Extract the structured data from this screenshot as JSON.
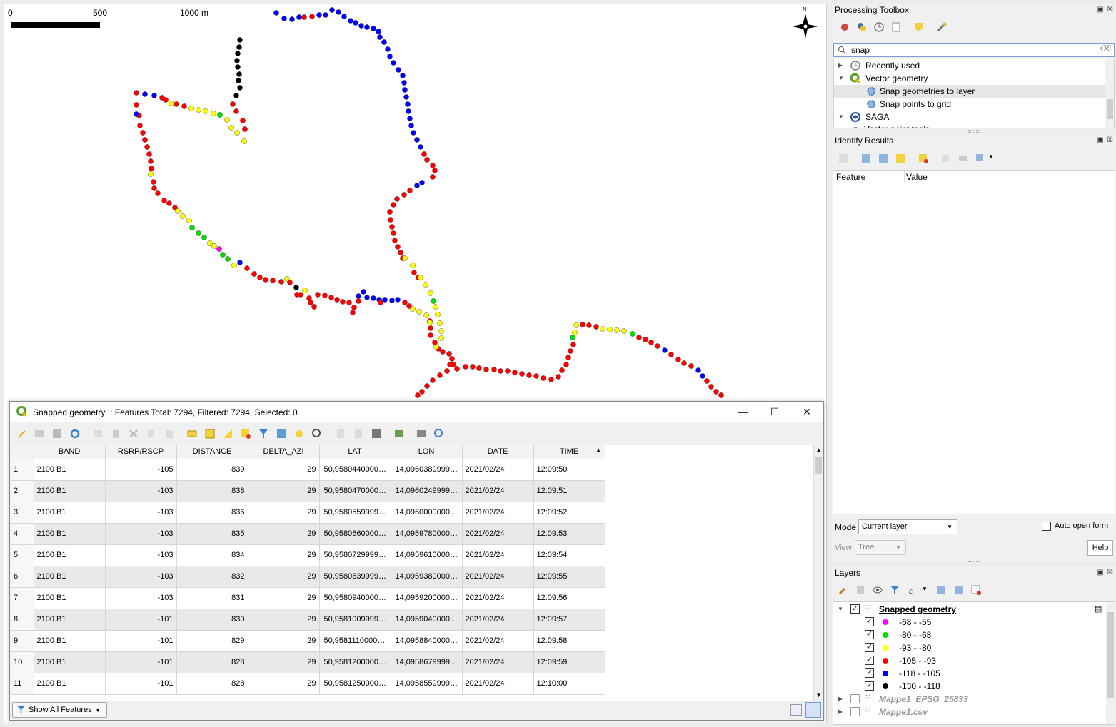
{
  "map": {
    "scale_labels": [
      "0",
      "500",
      "1000 m"
    ],
    "north_label": "N",
    "colors": {
      "magenta": "#ff00ff",
      "green": "#00dd00",
      "yellow": "#ffff00",
      "red": "#ff0000",
      "blue": "#0000ff",
      "black": "#000000"
    }
  },
  "attribute_table": {
    "title": "Snapped geometry :: Features Total: 7294, Filtered: 7294, Selected: 0",
    "columns": [
      "BAND",
      "RSRP/RSCP",
      "DISTANCE",
      "DELTA_AZI",
      "LAT",
      "LON",
      "DATE",
      "TIME"
    ],
    "rows": [
      {
        "n": "1",
        "band": "2100 B1",
        "rsrp": "-105",
        "distance": "839",
        "delta_azi": "29",
        "lat": "50,95804400000...",
        "lon": "14,09603899999...",
        "date": "2021/02/24",
        "time": "12:09:50"
      },
      {
        "n": "2",
        "band": "2100 B1",
        "rsrp": "-103",
        "distance": "838",
        "delta_azi": "29",
        "lat": "50,95804700000...",
        "lon": "14,09602499999...",
        "date": "2021/02/24",
        "time": "12:09:51"
      },
      {
        "n": "3",
        "band": "2100 B1",
        "rsrp": "-103",
        "distance": "836",
        "delta_azi": "29",
        "lat": "50,95805599999...",
        "lon": "14,09600000000...",
        "date": "2021/02/24",
        "time": "12:09:52"
      },
      {
        "n": "4",
        "band": "2100 B1",
        "rsrp": "-103",
        "distance": "835",
        "delta_azi": "29",
        "lat": "50,95806600000...",
        "lon": "14,09597800000...",
        "date": "2021/02/24",
        "time": "12:09:53"
      },
      {
        "n": "5",
        "band": "2100 B1",
        "rsrp": "-103",
        "distance": "834",
        "delta_azi": "29",
        "lat": "50,95807299999...",
        "lon": "14,09596100000...",
        "date": "2021/02/24",
        "time": "12:09:54"
      },
      {
        "n": "6",
        "band": "2100 B1",
        "rsrp": "-103",
        "distance": "832",
        "delta_azi": "29",
        "lat": "50,95808399999...",
        "lon": "14,09593800000...",
        "date": "2021/02/24",
        "time": "12:09:55"
      },
      {
        "n": "7",
        "band": "2100 B1",
        "rsrp": "-103",
        "distance": "831",
        "delta_azi": "29",
        "lat": "50,95809400000...",
        "lon": "14,09592000000...",
        "date": "2021/02/24",
        "time": "12:09:56"
      },
      {
        "n": "8",
        "band": "2100 B1",
        "rsrp": "-101",
        "distance": "830",
        "delta_azi": "29",
        "lat": "50,95810099999...",
        "lon": "14,09590400000...",
        "date": "2021/02/24",
        "time": "12:09:57"
      },
      {
        "n": "9",
        "band": "2100 B1",
        "rsrp": "-101",
        "distance": "829",
        "delta_azi": "29",
        "lat": "50,95811100000...",
        "lon": "14,09588400000...",
        "date": "2021/02/24",
        "time": "12:09:58"
      },
      {
        "n": "10",
        "band": "2100 B1",
        "rsrp": "-101",
        "distance": "828",
        "delta_azi": "29",
        "lat": "50,95812000000...",
        "lon": "14,09586799999...",
        "date": "2021/02/24",
        "time": "12:09:59"
      },
      {
        "n": "11",
        "band": "2100 B1",
        "rsrp": "-101",
        "distance": "828",
        "delta_azi": "29",
        "lat": "50,95812500000...",
        "lon": "14,09585599999...",
        "date": "2021/02/24",
        "time": "12:10:00"
      }
    ],
    "show_all_label": "Show All Features"
  },
  "processing": {
    "title": "Processing Toolbox",
    "search_value": "snap",
    "items": {
      "recent": "Recently used",
      "vector_geometry": "Vector geometry",
      "snap_layer": "Snap geometries to layer",
      "snap_grid": "Snap points to grid",
      "saga": "SAGA",
      "vector_point_tools": "Vector point tools"
    }
  },
  "identify": {
    "title": "Identify Results",
    "col_feature": "Feature",
    "col_value": "Value",
    "mode_label": "Mode",
    "mode_value": "Current layer",
    "auto_open": "Auto open form",
    "view_label": "View",
    "view_value": "Tree",
    "help": "Help"
  },
  "layers": {
    "title": "Layers",
    "layer_name": "Snapped geometry",
    "classes": [
      {
        "label": "-68 - -55",
        "color": "#ff00ff"
      },
      {
        "label": "-80 - -68",
        "color": "#00dd00"
      },
      {
        "label": "-93 - -80",
        "color": "#ffff00"
      },
      {
        "label": "-105 - -93",
        "color": "#ff0000"
      },
      {
        "label": "-118 - -105",
        "color": "#0000ff"
      },
      {
        "label": "-130 - -118",
        "color": "#000000"
      }
    ],
    "other": [
      "Mappe1_EPSG_25833",
      "Mappe1.csv"
    ]
  }
}
